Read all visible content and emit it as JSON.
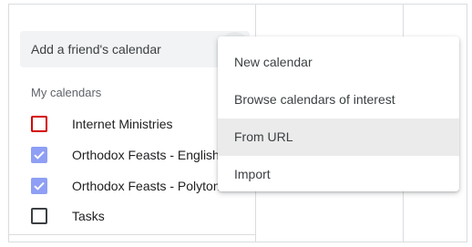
{
  "add_friend": {
    "placeholder": "Add a friend's calendar"
  },
  "my_calendars": {
    "header": "My calendars",
    "items": [
      {
        "label": "Internet Ministries",
        "checked": false,
        "color": "#d50000"
      },
      {
        "label": "Orthodox Feasts - English",
        "checked": true,
        "color": "#8e9ff5"
      },
      {
        "label": "Orthodox Feasts - Polytonic",
        "checked": true,
        "color": "#8e9ff5"
      },
      {
        "label": "Tasks",
        "checked": false,
        "color": "#3c4043"
      }
    ]
  },
  "menu": {
    "items": [
      {
        "label": "New calendar",
        "highlighted": false
      },
      {
        "label": "Browse calendars of interest",
        "highlighted": false
      },
      {
        "label": "From URL",
        "highlighted": true
      },
      {
        "label": "Import",
        "highlighted": false
      }
    ]
  }
}
